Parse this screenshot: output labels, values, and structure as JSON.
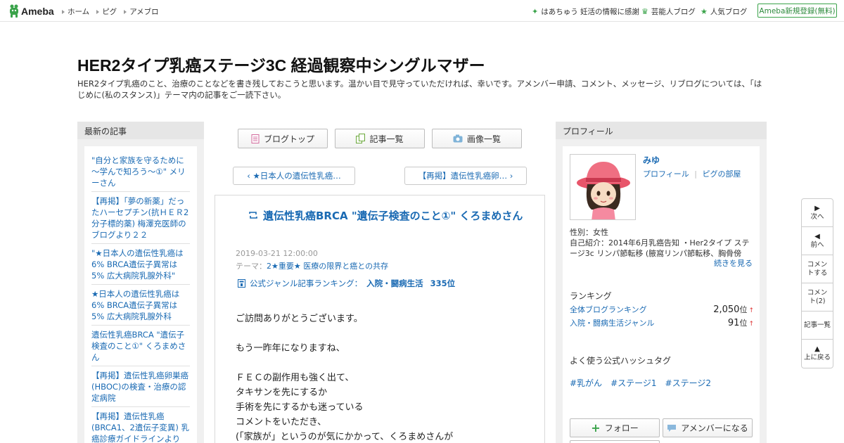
{
  "topbar": {
    "logo": "Ameba",
    "nav": [
      "ホーム",
      "ピグ",
      "アメブロ"
    ],
    "promo": "はあちゅう 妊活の情報に感謝",
    "celebrity": "芸能人ブログ",
    "popular": "人気ブログ",
    "signup": "Ameba新規登録(無料)"
  },
  "header": {
    "title": "HER2タイプ乳癌ステージ3C 経過観察中シングルマザー",
    "description": "HER2タイプ乳癌のこと、治療のことなどを書き残しておこうと思います。温かい目で見守っていただければ、幸いです。アメンバー申請、コメント、メッセージ、リブログについては、「はじめに(私のスタンス)」テーマ内の記事をご一読下さい。"
  },
  "left_sidebar": {
    "heading": "最新の記事",
    "items": [
      "\"自分と家族を守るために～学んで知ろう～①\" メリーさん",
      "【再掲】「夢の新薬」だったハーセプチン(抗ＨＥＲ2分子標的薬) 梅澤充医師のブログより２２",
      "\"★日本人の遺伝性乳癌は6% BRCA遺伝子異常は5% 広大病院乳腺外科\"",
      "★日本人の遺伝性乳癌は6% BRCA遺伝子異常は5% 広大病院乳腺外科",
      "遺伝性乳癌BRCA \"遺伝子検査のこと①\" くろまめさん",
      "【再掲】遺伝性乳癌卵巣癌(HBOC)の検査・治療の認定病院",
      "【再掲】遺伝性乳癌(BRCA1、2遺伝子変異) 乳癌診療ガイドラインより"
    ]
  },
  "center": {
    "buttons": {
      "top": "ブログトップ",
      "list": "記事一覧",
      "images": "画像一覧"
    },
    "prev": "‹ ★日本人の遺伝性乳癌…",
    "next": "【再掲】遺伝性乳癌卵… ›",
    "article": {
      "title": "遺伝性乳癌BRCA \"遺伝子検査のこと①\" くろまめさん",
      "date": "2019-03-21 12:00:00",
      "theme_label": "テーマ：",
      "theme": "2★重要★ 医療の限界と癌との共存",
      "rank_label": "公式ジャンル記事ランキング：",
      "rank_genre": "入院・闘病生活",
      "rank_value": "335位",
      "body": [
        "ご訪問ありがとうございます。",
        "",
        "もう一昨年になりますね、",
        "",
        "ＦＥＣの副作用も強く出て、",
        "タキサンを先にするか",
        "手術を先にするかも迷っている",
        "コメントをいただき、",
        "(「家族が」というのが気にかかって、くろまめさんが"
      ]
    }
  },
  "right_sidebar": {
    "heading": "プロフィール",
    "name": "みゆ",
    "profile_link": "プロフィール",
    "pig_link": "ピグの部屋",
    "gender": "性別：女性",
    "intro": "自己紹介：2014年6月乳癌告知 ・Her2タイプ ステージ3c リンパ節転移 (腋窩リンパ節転移、胸骨傍リ...",
    "more": "続きを見る",
    "ranking_label": "ランキング",
    "rankings": [
      {
        "name": "全体ブログランキング",
        "value": "2,050",
        "unit": "位",
        "trend": "↑"
      },
      {
        "name": "入院・闘病生活ジャンル",
        "value": "91",
        "unit": "位",
        "trend": "↑"
      }
    ],
    "hashtag_label": "よく使う公式ハッシュタグ",
    "hashtags": [
      "#乳がん",
      "#ステージ1",
      "#ステージ2"
    ],
    "follow": "フォロー",
    "amember": "アメンバーになる"
  },
  "floating_nav": [
    {
      "icon": "▶",
      "label": "次へ"
    },
    {
      "icon": "◀",
      "label": "前へ"
    },
    {
      "icon": "",
      "label": "コメントする"
    },
    {
      "icon": "",
      "label": "コメント(2)"
    },
    {
      "icon": "",
      "label": "記事一覧"
    },
    {
      "icon": "▲",
      "label": "上に戻る"
    }
  ],
  "colors": {
    "link": "#1a6ab3",
    "brand_green": "#3aa34a",
    "panel": "#e6e6e6"
  }
}
